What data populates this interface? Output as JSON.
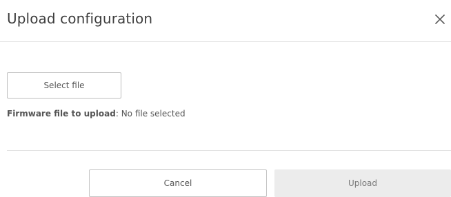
{
  "dialog": {
    "title": "Upload configuration",
    "close_icon": "close-icon"
  },
  "file_picker": {
    "select_label": "Select file",
    "status_label": "Firmware file to upload",
    "status_separator": ":",
    "status_value": "No file selected"
  },
  "footer": {
    "cancel_label": "Cancel",
    "upload_label": "Upload",
    "upload_disabled": true
  },
  "colors": {
    "text": "#444444",
    "border": "#bdbdbd",
    "divider": "#e3e3e3",
    "disabled_bg": "#ececec"
  }
}
